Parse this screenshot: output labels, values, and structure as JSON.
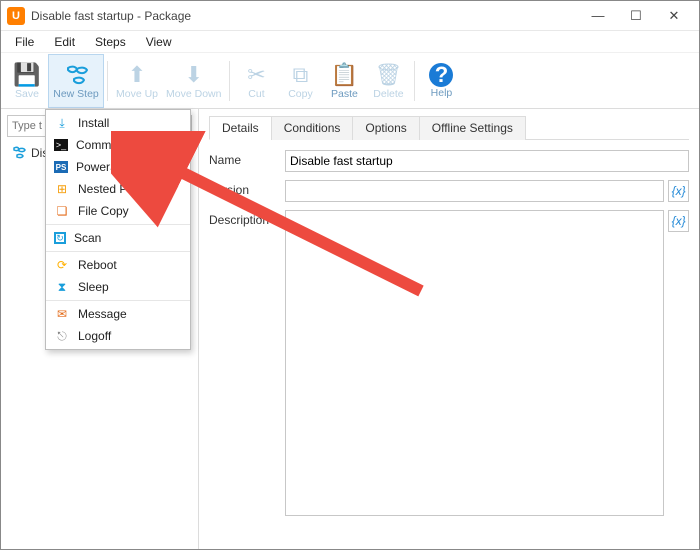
{
  "window": {
    "title": "Disable fast startup - Package",
    "app_icon_letter": "U"
  },
  "menu": {
    "file": "File",
    "edit": "Edit",
    "steps": "Steps",
    "view": "View"
  },
  "toolbar": {
    "save": "Save",
    "new_step": "New Step",
    "move_up": "Move Up",
    "move_down": "Move Down",
    "cut": "Cut",
    "copy": "Copy",
    "paste": "Paste",
    "delete": "Delete",
    "help": "Help"
  },
  "left": {
    "filter_placeholder": "Type t",
    "tree_item": "Dis"
  },
  "dropdown": {
    "items": [
      {
        "label": "Install",
        "icon": "install",
        "color": "#1a9edb"
      },
      {
        "label": "Command",
        "icon": "cmd",
        "color": "#111"
      },
      {
        "label": "PowerShell",
        "icon": "ps",
        "color": "#1b6bb5"
      },
      {
        "label": "Nested Package",
        "icon": "nested",
        "color": "#f59e0b"
      },
      {
        "label": "File Copy",
        "icon": "filecopy",
        "color": "#e36b1a"
      },
      {
        "label": "Scan",
        "icon": "scan",
        "color": "#1a9edb"
      },
      {
        "label": "Reboot",
        "icon": "reboot",
        "color": "#ffb000"
      },
      {
        "label": "Sleep",
        "icon": "sleep",
        "color": "#1a9edb"
      },
      {
        "label": "Message",
        "icon": "message",
        "color": "#e36b1a"
      },
      {
        "label": "Logoff",
        "icon": "logoff",
        "color": "#888"
      }
    ]
  },
  "tabs": {
    "details": "Details",
    "conditions": "Conditions",
    "options": "Options",
    "offline": "Offline Settings"
  },
  "form": {
    "name_label": "Name",
    "name_value": "Disable fast startup",
    "version_label": "Version",
    "version_value": "",
    "description_label": "Description",
    "description_value": "",
    "var_button": "{x}"
  }
}
